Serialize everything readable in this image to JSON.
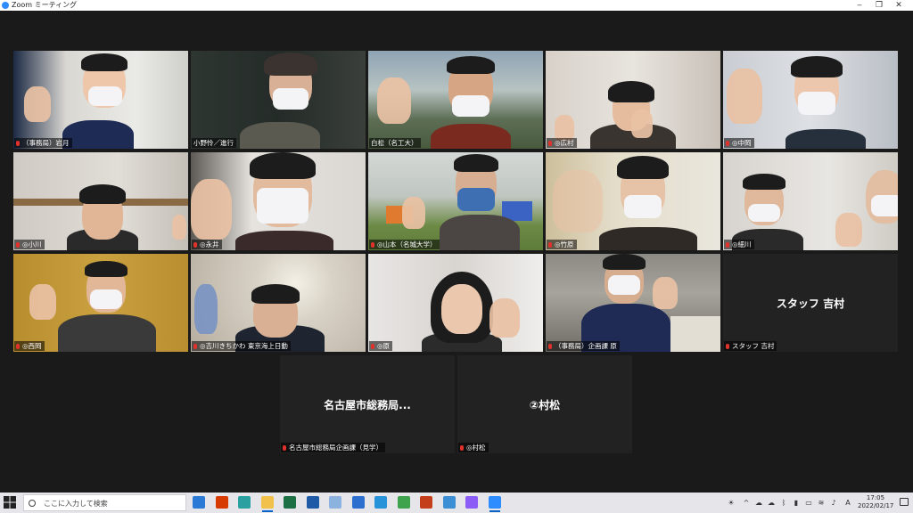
{
  "window": {
    "title": "Zoom ミーティング",
    "minimize": "‒",
    "restore": "❐",
    "close": "✕"
  },
  "participants": [
    {
      "name": "（事務局）岩月",
      "muted": true,
      "active": false
    },
    {
      "name": "小野怜／進行",
      "muted": false,
      "active": true
    },
    {
      "name": "白松（名工大）",
      "muted": false,
      "active": false
    },
    {
      "name": "◎広村",
      "muted": true,
      "active": false
    },
    {
      "name": "◎中岡",
      "muted": true,
      "active": false
    },
    {
      "name": "◎小川",
      "muted": true,
      "active": false
    },
    {
      "name": "◎永井",
      "muted": true,
      "active": false
    },
    {
      "name": "◎山本（名城大学）",
      "muted": true,
      "active": false
    },
    {
      "name": "◎竹原",
      "muted": true,
      "active": false
    },
    {
      "name": "◎細川",
      "muted": true,
      "active": false
    },
    {
      "name": "◎西岡",
      "muted": true,
      "active": false
    },
    {
      "name": "◎吉川きちかわ 東京海上日動",
      "muted": true,
      "active": false
    },
    {
      "name": "◎原",
      "muted": true,
      "active": false
    },
    {
      "name": "（事務局）企画課 原",
      "muted": true,
      "active": false
    },
    {
      "name": "スタッフ 吉村",
      "display": "スタッフ 吉村",
      "muted": true,
      "active": false
    },
    {
      "name": "名古屋市総務局企画課（見学）",
      "display": "名古屋市総務局...",
      "muted": true,
      "active": false
    },
    {
      "name": "◎村松",
      "display": "②村松",
      "muted": true,
      "active": false
    }
  ],
  "taskbar": {
    "search_placeholder": "ここに入力して検索",
    "apps": [
      {
        "icon": "lync-icon",
        "color": "#2b7bd6"
      },
      {
        "icon": "office-icon",
        "color": "#d83b01"
      },
      {
        "icon": "edge-icon",
        "color": "#2aa1a0"
      },
      {
        "icon": "explorer-icon",
        "color": "#f2c14b"
      },
      {
        "icon": "excel-icon",
        "color": "#1d7044"
      },
      {
        "icon": "word-icon",
        "color": "#1f5aa6"
      },
      {
        "icon": "paint-icon",
        "color": "#8cb3e0"
      },
      {
        "icon": "mail-icon",
        "color": "#2d6fcf"
      },
      {
        "icon": "network-icon",
        "color": "#2893d8"
      },
      {
        "icon": "chrome-icon",
        "color": "#3fa34d"
      },
      {
        "icon": "powerpoint-icon",
        "color": "#c43e1c"
      },
      {
        "icon": "remote-desktop-icon",
        "color": "#3c8fd4"
      },
      {
        "icon": "messenger-icon",
        "color": "#8b5cf6"
      },
      {
        "icon": "zoom-icon",
        "color": "#2d8cff"
      }
    ],
    "ime_mode": "A",
    "time": "17:05",
    "date": "2022/02/17"
  },
  "colors": {
    "active_speaker": "#c7d93a",
    "muted_mic": "#e0312b",
    "stage_bg": "#1a1a1a"
  }
}
